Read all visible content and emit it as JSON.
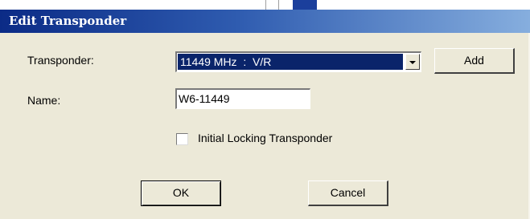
{
  "dialog": {
    "title": "Edit Transponder",
    "transponder_label": "Transponder:",
    "transponder_selected": "11449 MHz  :  V/R",
    "add_label": "Add",
    "name_label": "Name:",
    "name_value": "W6-11449",
    "checkbox_label": "Initial Locking Transponder",
    "checkbox_checked": false,
    "ok_label": "OK",
    "cancel_label": "Cancel"
  }
}
